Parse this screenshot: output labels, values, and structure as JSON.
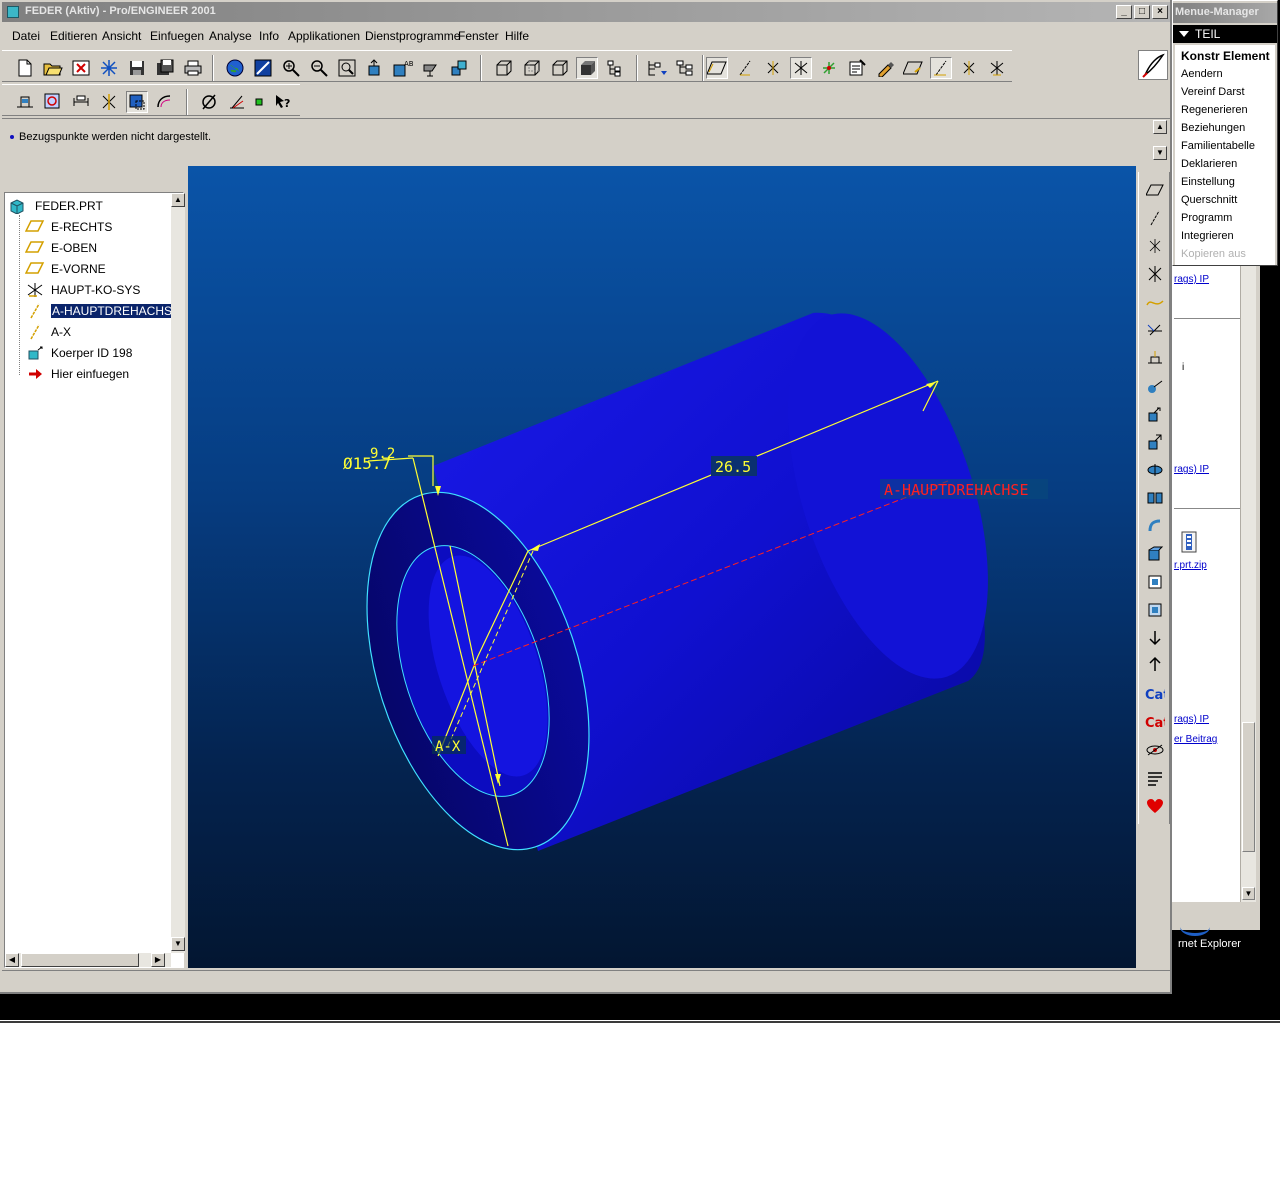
{
  "window": {
    "title": "FEDER (Aktiv) - Pro/ENGINEER 2001",
    "controls": [
      "_",
      "□",
      "×"
    ]
  },
  "menubar": {
    "items": [
      {
        "label": "Datei"
      },
      {
        "label": "Editieren"
      },
      {
        "label": "Ansicht"
      },
      {
        "label": "Einfuegen"
      },
      {
        "label": "Analyse"
      },
      {
        "label": "Info"
      },
      {
        "label": "Applikationen"
      },
      {
        "label": "Dienstprogramme"
      },
      {
        "label": "Fenster"
      },
      {
        "label": "Hilfe"
      }
    ]
  },
  "message": {
    "text": "Bezugspunkte werden nicht dargestellt."
  },
  "model_tree": {
    "root": "FEDER.PRT",
    "items": [
      {
        "label": "E-RECHTS",
        "icon": "datum-plane-icon"
      },
      {
        "label": "E-OBEN",
        "icon": "datum-plane-icon"
      },
      {
        "label": "E-VORNE",
        "icon": "datum-plane-icon"
      },
      {
        "label": "HAUPT-KO-SYS",
        "icon": "coordinate-system-icon"
      },
      {
        "label": "A-HAUPTDREHACHSE",
        "icon": "datum-axis-icon",
        "selected": true
      },
      {
        "label": "A-X",
        "icon": "datum-axis-icon"
      },
      {
        "label": "Koerper ID 198",
        "icon": "revolve-feature-icon"
      },
      {
        "label": "Hier einfuegen",
        "icon": "insert-arrow-icon"
      }
    ]
  },
  "graphics": {
    "dim_diameter_outer": "Ø15.7",
    "dim_diameter_inner": "9.2",
    "dim_length": "26.5",
    "axis_main_label": "A-HAUPTDREHACHSE",
    "axis_x_label": "A-X",
    "colors": {
      "part": "#1414e0",
      "dimension": "#ffff33",
      "axis": "#ff2020",
      "edge": "#40e0ff"
    }
  },
  "menu_manager": {
    "title": "Menue-Manager",
    "section": "TEIL",
    "items": [
      {
        "label": "Konstr Element",
        "bold": true
      },
      {
        "label": "Aendern"
      },
      {
        "label": "Vereinf Darst"
      },
      {
        "label": "Regenerieren"
      },
      {
        "label": "Beziehungen"
      },
      {
        "label": "Familientabelle"
      },
      {
        "label": "Deklarieren"
      },
      {
        "label": "Einstellung"
      },
      {
        "label": "Querschnitt"
      },
      {
        "label": "Programm"
      },
      {
        "label": "Integrieren"
      },
      {
        "label": "Kopieren aus",
        "disabled": true
      }
    ]
  },
  "background_browser": {
    "links": [
      "rags) IP",
      "rags) IP",
      "r.prt.zip",
      "rags) IP",
      "er Beitrag"
    ],
    "text_fragment": "i",
    "desktop_label": "rnet Explorer"
  }
}
